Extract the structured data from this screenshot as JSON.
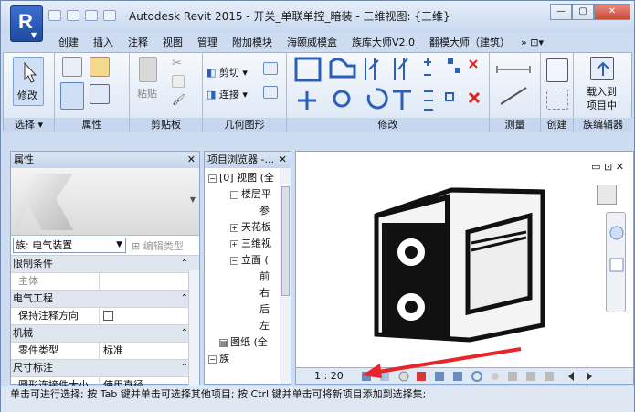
{
  "title": "Autodesk Revit 2015 -      开关_单联单控_暗装 - 三维视图: {三维}",
  "tabs": [
    "创建",
    "插入",
    "注释",
    "视图",
    "管理",
    "附加模块",
    "海颐威模盒",
    "族库大师V2.0",
    "翻模大师（建筑）"
  ],
  "tabs_more": "»  ⊡▾",
  "ribbon": {
    "select": {
      "label": "选择 ▾",
      "modify": "修改"
    },
    "properties": {
      "label": "属性"
    },
    "clipboard": {
      "label": "剪贴板",
      "paste": "粘贴"
    },
    "geometry": {
      "label": "几何图形",
      "cut": "剪切",
      "join": "连接"
    },
    "modify": {
      "label": "修改"
    },
    "measure": {
      "label": "测量"
    },
    "create": {
      "label": "创建"
    },
    "family_editor": {
      "label": "族编辑器",
      "load": "载入到",
      "load2": "项目中"
    }
  },
  "properties_panel": {
    "title": "属性",
    "family_value": "族: 电气装置",
    "edit_type": "编辑类型",
    "rows": [
      {
        "kind": "group",
        "label": "限制条件"
      },
      {
        "kind": "gray",
        "key": "主体",
        "value": ""
      },
      {
        "kind": "group",
        "label": "电气工程"
      },
      {
        "kind": "check",
        "key": "保持注释方向",
        "value": ""
      },
      {
        "kind": "group",
        "label": "机械"
      },
      {
        "kind": "row",
        "key": "零件类型",
        "value": "标准"
      },
      {
        "kind": "group",
        "label": "尺寸标注"
      },
      {
        "kind": "row",
        "key": "圆形连接件大小",
        "value": "使用直径"
      }
    ]
  },
  "browser": {
    "title": "项目浏览器 -...",
    "items": [
      "[0] 视图 (全",
      "楼层平",
      "参",
      "天花板",
      "三维视",
      "立面 (",
      "前",
      "右",
      "后",
      "左",
      "图纸 (全",
      "族"
    ]
  },
  "view": {
    "scale": "1 : 20",
    "controls": "▭ ⊡ ✕"
  },
  "status": "单击可进行选择; 按 Tab 键并单击可选择其他项目; 按 Ctrl 键并单击可将新项目添加到选择集;",
  "colors": {
    "accent": "#2b5fb8",
    "ribbon": "#dbe6f4",
    "close": "#c74b3a",
    "arrow": "#e8252a"
  }
}
